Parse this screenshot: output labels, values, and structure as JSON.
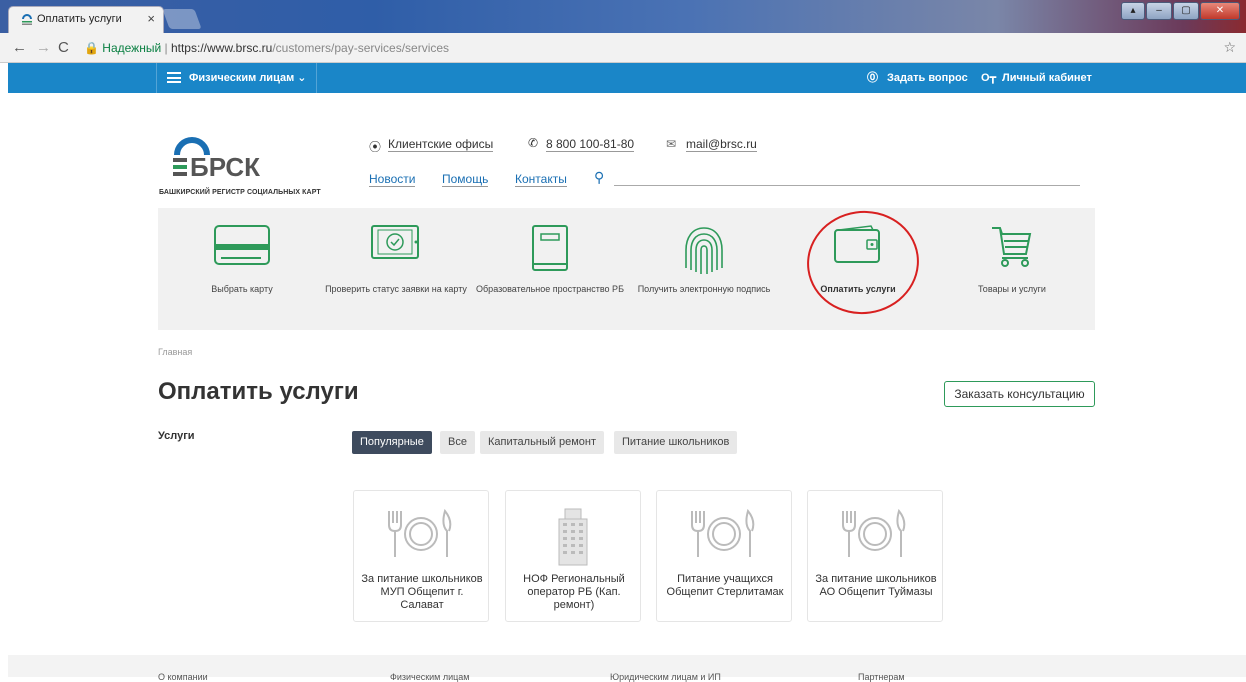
{
  "browser": {
    "tab_title": "Оплатить услуги",
    "tab_close": "×",
    "secure_label": "Надежный",
    "url_base": "https://www.brsc.ru",
    "url_path": "/customers/pay-services/services"
  },
  "topbar": {
    "menu_label": "Физическим лицам",
    "ask_question": "Задать вопрос",
    "personal_account": "Личный кабинет"
  },
  "header": {
    "logo_subtitle": "БАШКИРСКИЙ РЕГИСТР СОЦИАЛЬНЫХ КАРТ",
    "offices": "Клиентские офисы",
    "phone": "8 800 100-81-80",
    "email": "mail@brsc.ru",
    "nav": [
      "Новости",
      "Помощь",
      "Контакты"
    ]
  },
  "categories": [
    {
      "label": "Выбрать карту",
      "icon": "card-icon"
    },
    {
      "label": "Проверить статус заявки на карту",
      "icon": "tablet-check-icon"
    },
    {
      "label": "Образовательное пространство РБ",
      "icon": "book-icon"
    },
    {
      "label": "Получить электронную подпись",
      "icon": "fingerprint-icon"
    },
    {
      "label": "Оплатить услуги",
      "icon": "wallet-icon",
      "active": true
    },
    {
      "label": "Товары и услуги",
      "icon": "cart-icon"
    }
  ],
  "breadcrumb": "Главная",
  "page_title": "Оплатить услуги",
  "consult_button": "Заказать консультацию",
  "services_label": "Услуги",
  "filters": [
    "Популярные",
    "Все",
    "Капитальный ремонт",
    "Питание школьников"
  ],
  "services": [
    {
      "title": "За питание школьников МУП Общепит г. Салават",
      "icon": "plate-icon"
    },
    {
      "title": "НОФ Региональный оператор РБ (Кап. ремонт)",
      "icon": "building-icon"
    },
    {
      "title": "Питание учащихся Общепит Стерлитамак",
      "icon": "plate-icon"
    },
    {
      "title": "За питание школьников АО Общепит Туймазы",
      "icon": "plate-icon"
    }
  ],
  "footer": [
    "О компании",
    "Физическим лицам",
    "Юридическим лицам и ИП",
    "Партнерам"
  ],
  "colors": {
    "accent_blue": "#1a86c8",
    "accent_green": "#2e9a5a",
    "highlight_red": "#d82020"
  }
}
